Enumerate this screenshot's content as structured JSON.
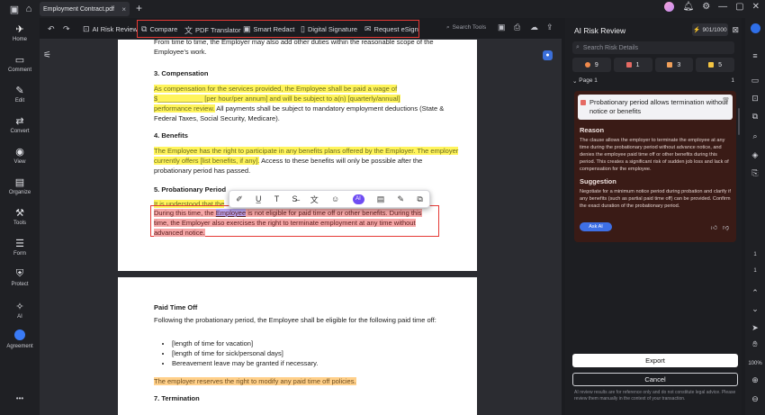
{
  "titlebar": {
    "tab_title": "Employment Contract.pdf",
    "close_glyph": "×",
    "new_tab_glyph": "+"
  },
  "left_rail": {
    "items": [
      {
        "label": "Home",
        "icon": "home-icon",
        "glyph": "⌂"
      },
      {
        "label": "Comment",
        "icon": "comment-icon",
        "glyph": "▭"
      },
      {
        "label": "Edit",
        "icon": "edit-icon",
        "glyph": "✎"
      },
      {
        "label": "Convert",
        "icon": "convert-icon",
        "glyph": "⇄"
      },
      {
        "label": "View",
        "icon": "view-icon",
        "glyph": "◉"
      },
      {
        "label": "Organize",
        "icon": "organize-icon",
        "glyph": "▤"
      },
      {
        "label": "Tools",
        "icon": "tools-icon",
        "glyph": "⚒"
      },
      {
        "label": "Form",
        "icon": "form-icon",
        "glyph": "☰"
      },
      {
        "label": "Protect",
        "icon": "protect-icon",
        "glyph": "⛨"
      },
      {
        "label": "AI",
        "icon": "ai-wand-icon",
        "glyph": "✧"
      },
      {
        "label": "Agreement",
        "icon": "agreement-icon",
        "glyph": ""
      }
    ],
    "more": "•••"
  },
  "toolbar": {
    "ai_risk_review": "AI Risk Review",
    "compare": "Compare",
    "pdf_translator": "PDF Translator",
    "smart_redact": "Smart Redact",
    "digital_signature": "Digital Signature",
    "request_esign": "Request eSign",
    "search_tools": "Search Tools"
  },
  "document": {
    "page1": {
      "intro": "From time to time, the Employer may also add other duties within the reasonable scope of the Employee’s work.",
      "sec3_heading": "3.   Compensation",
      "sec3_hl_a": "As compensation for the services provided, the Employee shall be paid a wage of",
      "sec3_hl_b": "$____________ [per hour/per annum] and will be subject to a(n) [quarterly/annual]",
      "sec3_hl_c": "performance review.",
      "sec3_rest": " All payments shall be subject to mandatory employment deductions (State & Federal Taxes, Social Security, Medicare).",
      "sec4_heading": "4.   Benefits",
      "sec4_hl": "The Employee has the right to participate in any benefits plans offered by the Employer. The employer currently offers [list benefits, if any].",
      "sec4_rest": " Access to these benefits will only be possible after the probationary period has passed.",
      "sec5_heading": "5.   Probationary Period",
      "sec5_line1": "It is understood that the ",
      "sec5_line2_a": "During this time, the ",
      "sec5_line2_sel": "Employee",
      "sec5_line2_b": " is not eligible for paid time off or other benefits. During this",
      "sec5_line3": "time, the Employer also exercises the right to terminate employment at any time without",
      "sec5_line4": "advanced notice."
    },
    "page2": {
      "pto_heading": "Paid Time Off",
      "pto_text": "Following the probationary period, the Employee shall be eligible for the following paid time off:",
      "bullets": [
        "[length of time for vacation]",
        "[length of time for sick/personal days]",
        "Bereavement leave may be granted if necessary."
      ],
      "pto_hl": "The employer reserves the right to modify any paid time off policies.",
      "sec7_heading": "7.   Termination"
    }
  },
  "float_toolbar": {
    "ai_label": "AI",
    "icons": [
      "highlight-icon",
      "underline-icon",
      "text-icon",
      "strikethrough-icon",
      "translate-icon",
      "chat-icon",
      "ai-icon",
      "attach-icon",
      "edit-icon",
      "copy-icon"
    ]
  },
  "panel": {
    "title": "AI Risk Review",
    "credits": "901/1000",
    "search_placeholder": "Search Risk Details",
    "counts": [
      {
        "value": "9",
        "color": "#f08a4b",
        "icon": "all-icon"
      },
      {
        "value": "1",
        "color": "#e56a63",
        "icon": "high-risk-icon"
      },
      {
        "value": "3",
        "color": "#f0a05a",
        "icon": "medium-risk-icon"
      },
      {
        "value": "5",
        "color": "#f5c542",
        "icon": "low-risk-icon"
      }
    ],
    "page_label": "Page 1",
    "page_count": "1",
    "risk": {
      "title": "Probationary period allows termination without notice or benefits",
      "reason_heading": "Reason",
      "reason_text": "The clause allows the employer to terminate the employee at any time during the probationary period without advance notice, and denies the employee paid time off or other benefits during this period. This creates a significant risk of sudden job loss and lack of compensation for the employee.",
      "suggestion_heading": "Suggestion",
      "suggestion_text": "Negotiate for a minimum notice period during probation and clarify if any benefits (such as partial paid time off) can be provided. Confirm the exact duration of the probationary period.",
      "ask_ai": "Ask AI"
    },
    "export": "Export",
    "cancel": "Cancel",
    "disclaimer": "AI review results are for reference only and do not constitute legal advice. Please review them manually in the context of your transaction."
  },
  "right_rail": {
    "page_num": "1",
    "page_total": "1",
    "zoom": "100%"
  }
}
